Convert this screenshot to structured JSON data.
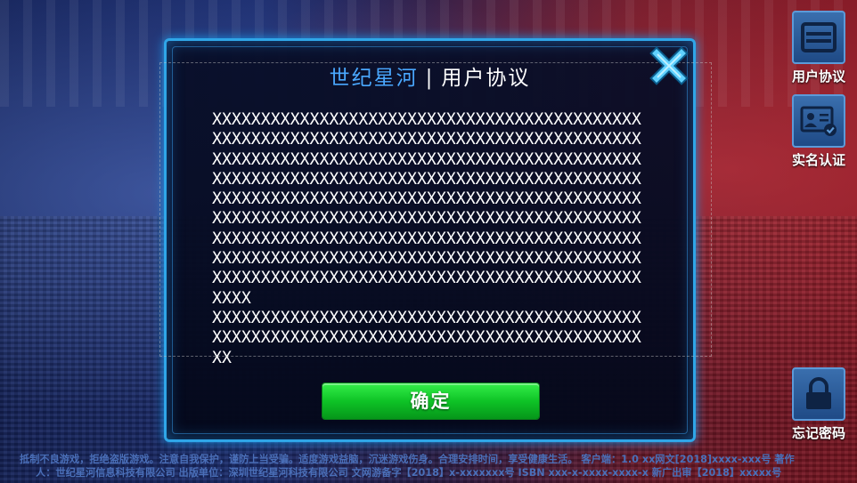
{
  "dialog": {
    "title_brand": "世纪星河",
    "title_sep": "|",
    "title_name": "用户协议",
    "content_lines": [
      "XXXXXXXXXXXXXXXXXXXXXXXXXXXXXXXXXXXXXXXXXXXX",
      "XXXXXXXXXXXXXXXXXXXXXXXXXXXXXXXXXXXXXXXXXXXX",
      "XXXXXXXXXXXXXXXXXXXXXXXXXXXXXXXXXXXXXXXXXXXX",
      "XXXXXXXXXXXXXXXXXXXXXXXXXXXXXXXXXXXXXXXXXXXX",
      "XXXXXXXXXXXXXXXXXXXXXXXXXXXXXXXXXXXXXXXXXXXX",
      "XXXXXXXXXXXXXXXXXXXXXXXXXXXXXXXXXXXXXXXXXXXX",
      "XXXXXXXXXXXXXXXXXXXXXXXXXXXXXXXXXXXXXXXXXXXX",
      "XXXXXXXXXXXXXXXXXXXXXXXXXXXXXXXXXXXXXXXXXXXX",
      "XXXXXXXXXXXXXXXXXXXXXXXXXXXXXXXXXXXXXXXXXXXX",
      "XXXX",
      "XXXXXXXXXXXXXXXXXXXXXXXXXXXXXXXXXXXXXXXXXXXX",
      "XXXXXXXXXXXXXXXXXXXXXXXXXXXXXXXXXXXXXXXXXXXX",
      "XX"
    ],
    "confirm_label": "确定",
    "close_icon": "close-x-icon"
  },
  "side": {
    "agreement_label": "用户协议",
    "agreement_icon": "agreement-card-icon",
    "realname_label": "实名认证",
    "realname_icon": "id-card-check-icon",
    "forgot_label": "忘记密码",
    "forgot_icon": "lock-icon"
  },
  "footer": {
    "line1": "抵制不良游戏，拒绝盗版游戏。注意自我保护，谨防上当受骗。适度游戏益脑，沉迷游戏伤身。合理安排时间，享受健康生活。   客户端：1.0  xx网文[2018]xxxx-xxx号  著作",
    "line2": "人：世纪星河信息科技有限公司   出版单位：深圳世纪星河科技有限公司   文网游备字【2018】x-xxxxxxx号  ISBN xxx-x-xxxx-xxxx-x  新广出审【2018】xxxxx号"
  },
  "colors": {
    "frame": "#2fa6e8",
    "brand": "#4aa8ff",
    "confirm": "#0ec326",
    "footer_text": "#4a6fb8"
  }
}
